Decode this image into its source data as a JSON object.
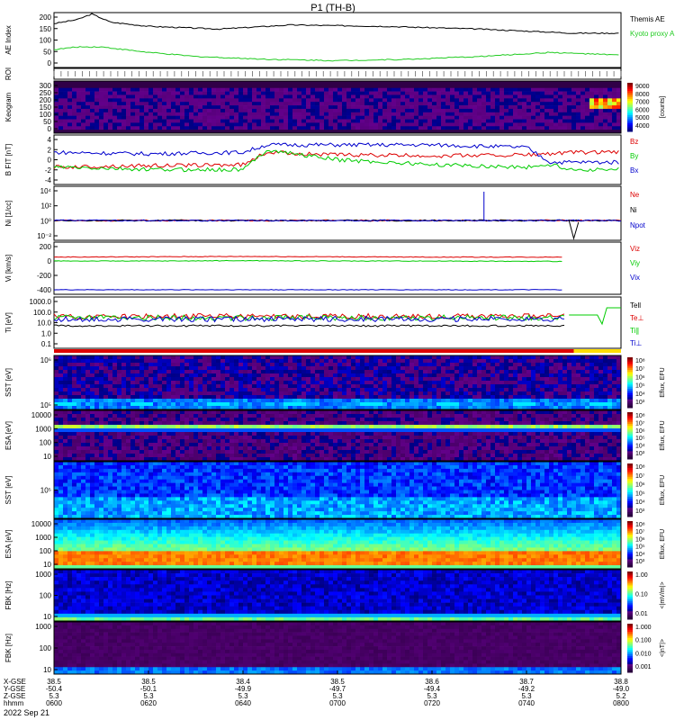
{
  "chart_data": {
    "type": "line",
    "title": "P1 (TH-B)",
    "date_label": "2022 Sep 21",
    "x_axis": {
      "row_labels": [
        "X-GSE",
        "Y-GSE",
        "Z-GSE",
        "hhmm"
      ],
      "ticks": [
        {
          "time": "0600",
          "x_gse": "38.5",
          "y_gse": "-50.4",
          "z_gse": "5.3"
        },
        {
          "time": "0620",
          "x_gse": "38.5",
          "y_gse": "-50.1",
          "z_gse": "5.3"
        },
        {
          "time": "0640",
          "x_gse": "38.4",
          "y_gse": "-49.9",
          "z_gse": "5.3"
        },
        {
          "time": "0700",
          "x_gse": "38.5",
          "y_gse": "-49.7",
          "z_gse": "5.3"
        },
        {
          "time": "0720",
          "x_gse": "38.6",
          "y_gse": "-49.4",
          "z_gse": "5.3"
        },
        {
          "time": "0740",
          "x_gse": "38.7",
          "y_gse": "-49.2",
          "z_gse": "5.3"
        },
        {
          "time": "0800",
          "x_gse": "38.8",
          "y_gse": "-49.0",
          "z_gse": "5.2"
        }
      ]
    },
    "panels": [
      {
        "id": "ae",
        "ylabel": "AE Index",
        "yticks": [
          "200",
          "150",
          "100",
          "50",
          "0"
        ],
        "ylim": [
          0,
          200
        ],
        "series": [
          {
            "name": "Themis AE",
            "color": "#000000",
            "x": [
              0,
              5,
              8,
              12,
              20,
              35,
              50,
              70,
              90,
              110,
              120
            ],
            "y": [
              160,
              175,
              195,
              165,
              150,
              140,
              155,
              150,
              140,
              125,
              125
            ]
          },
          {
            "name": "Kyoto proxy AE",
            "color": "#22cc22",
            "x": [
              0,
              5,
              10,
              20,
              30,
              45,
              60,
              75,
              90,
              105,
              120
            ],
            "y": [
              65,
              75,
              75,
              55,
              40,
              30,
              25,
              30,
              40,
              55,
              45
            ]
          }
        ]
      },
      {
        "id": "roi",
        "ylabel": "ROI"
      },
      {
        "id": "keogram",
        "ylabel": "Keogram",
        "yticks": [
          "300",
          "250",
          "200",
          "150",
          "100",
          "50",
          "0"
        ],
        "colorbar": {
          "label": "[counts]",
          "ticks": [
            "9000",
            "8000",
            "7000",
            "6000",
            "5000",
            "4000"
          ]
        }
      },
      {
        "id": "bfgm",
        "ylabel": "B FIT [nT]",
        "yticks": [
          "4",
          "2",
          "0",
          "-2",
          "-4"
        ],
        "ylim": [
          -5,
          5
        ],
        "series": [
          {
            "name": "Bz",
            "color": "#dd0000",
            "x": [
              0,
              20,
              40,
              45,
              60,
              80,
              100,
              105,
              110,
              120
            ],
            "y": [
              -1.5,
              -1.2,
              -1,
              1.5,
              1,
              0.8,
              1,
              1.2,
              1.5,
              1.5
            ]
          },
          {
            "name": "By",
            "color": "#00cc00",
            "x": [
              0,
              20,
              40,
              45,
              60,
              80,
              100,
              105,
              110,
              120
            ],
            "y": [
              -1.5,
              -2,
              -2,
              2,
              0,
              -1,
              -1.5,
              -1,
              -2,
              -2
            ]
          },
          {
            "name": "Bx",
            "color": "#0000cc",
            "x": [
              0,
              20,
              40,
              45,
              60,
              80,
              100,
              105,
              110,
              120
            ],
            "y": [
              1.5,
              1.2,
              1.5,
              3,
              3,
              3,
              2.5,
              -0.5,
              -0.5,
              -0.5
            ]
          }
        ]
      },
      {
        "id": "density",
        "ylabel": "Ni [1/cc]",
        "yticks": [
          "10⁴",
          "10²",
          "10⁰",
          "10⁻²"
        ],
        "series_names": [
          "Ne",
          "Ni",
          "Npot"
        ],
        "series_colors": [
          "#dd0000",
          "#000000",
          "#0000cc"
        ]
      },
      {
        "id": "velocity",
        "ylabel": "Vi [km/s]",
        "yticks": [
          "200",
          "0",
          "-200",
          "-400"
        ],
        "ylim": [
          -500,
          300
        ],
        "series": [
          {
            "name": "Viz",
            "color": "#dd0000",
            "x": [
              0,
              20,
              40,
              60,
              80,
              100,
              108
            ],
            "y": [
              70,
              75,
              80,
              75,
              70,
              70,
              70
            ]
          },
          {
            "name": "Viy",
            "color": "#00cc00",
            "x": [
              0,
              20,
              40,
              60,
              80,
              100,
              108
            ],
            "y": [
              10,
              10,
              15,
              10,
              10,
              5,
              5
            ]
          },
          {
            "name": "Vix",
            "color": "#0000cc",
            "x": [
              0,
              20,
              40,
              60,
              80,
              100,
              108
            ],
            "y": [
              -430,
              -430,
              -430,
              -430,
              -430,
              -430,
              -430
            ]
          }
        ]
      },
      {
        "id": "temp",
        "ylabel": "Ti [eV]",
        "yticks": [
          "1000.0",
          "100.0",
          "10.0",
          "1.0",
          "0.1"
        ],
        "series_names": [
          "Tell",
          "Te⊥",
          "Ti∥",
          "Ti⊥"
        ],
        "series_colors": [
          "#000000",
          "#dd0000",
          "#00cc00",
          "#0000cc"
        ]
      },
      {
        "id": "sst_e",
        "ylabel": "SST [eV]",
        "yticks": [
          "10⁶",
          "10⁵"
        ],
        "colorbar": {
          "label": "Eflux, EFU",
          "ticks": [
            "10⁸",
            "10⁷",
            "10⁶",
            "10⁵",
            "10⁴",
            "10³"
          ]
        }
      },
      {
        "id": "esa_e",
        "ylabel": "ESA [eV]",
        "yticks": [
          "10000",
          "1000",
          "100",
          "10"
        ],
        "colorbar": {
          "label": "Eflux, EFU",
          "ticks": [
            "10⁸",
            "10⁷",
            "10⁶",
            "10⁵",
            "10⁴",
            "10³"
          ]
        }
      },
      {
        "id": "sst_i",
        "ylabel": "SST [eV]",
        "yticks": [
          "10⁵"
        ],
        "colorbar": {
          "label": "Eflux, EFU",
          "ticks": [
            "10⁸",
            "10⁷",
            "10⁶",
            "10⁵",
            "10⁴",
            "10³"
          ]
        }
      },
      {
        "id": "esa_i",
        "ylabel": "ESA [eV]",
        "yticks": [
          "10000",
          "1000",
          "100",
          "10"
        ],
        "colorbar": {
          "label": "Eflux, EFU",
          "ticks": [
            "10⁸",
            "10⁷",
            "10⁶",
            "10⁵",
            "10⁴",
            "10³"
          ]
        }
      },
      {
        "id": "fbk_e",
        "ylabel": "FBK [Hz]",
        "yticks": [
          "1000",
          "100",
          "10"
        ],
        "colorbar": {
          "label": "<|mV/m|>",
          "ticks": [
            "1.00",
            "0.10",
            "0.01"
          ]
        }
      },
      {
        "id": "fbk_b",
        "ylabel": "FBK [Hz]",
        "yticks": [
          "1000",
          "100",
          "10"
        ],
        "colorbar": {
          "label": "<|nT|>",
          "ticks": [
            "1.000",
            "0.100",
            "0.010",
            "0.001"
          ]
        }
      }
    ]
  }
}
